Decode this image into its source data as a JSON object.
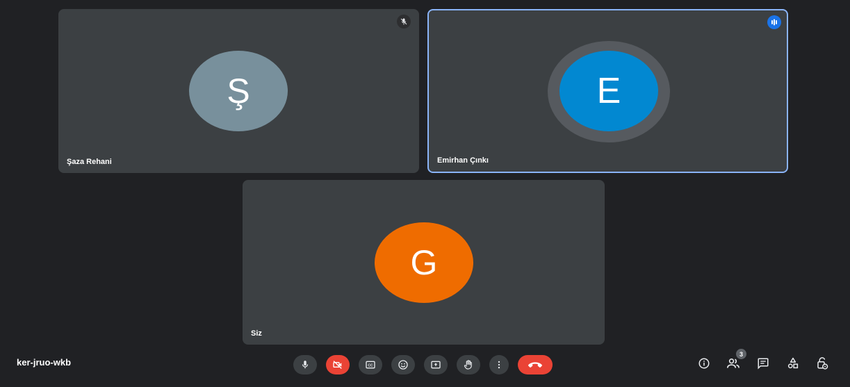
{
  "meeting": {
    "code": "ker-jruo-wkb"
  },
  "participants": [
    {
      "name": "Şaza Rehani",
      "initial": "Ş",
      "avatar_color": "#78909c",
      "status_icon": "mic-off-icon"
    },
    {
      "name": "Emirhan Çınkı",
      "initial": "E",
      "avatar_color": "#0288d1",
      "status_icon": "speaking-icon",
      "speaking": true
    },
    {
      "name": "Siz",
      "initial": "G",
      "avatar_color": "#ef6c00"
    }
  ],
  "controls": [
    "mic-icon",
    "camera-off-icon",
    "captions-icon",
    "emoji-icon",
    "present-screen-icon",
    "raise-hand-icon",
    "more-options-icon",
    "end-call-icon"
  ],
  "right_controls": [
    "info-icon",
    "people-icon",
    "chat-icon",
    "activities-icon",
    "host-controls-icon"
  ],
  "people_count": "3",
  "colors": {
    "background": "#202124",
    "tile": "#3c4043",
    "speaking_border": "#8ab4f8",
    "end_call": "#ea4335"
  }
}
